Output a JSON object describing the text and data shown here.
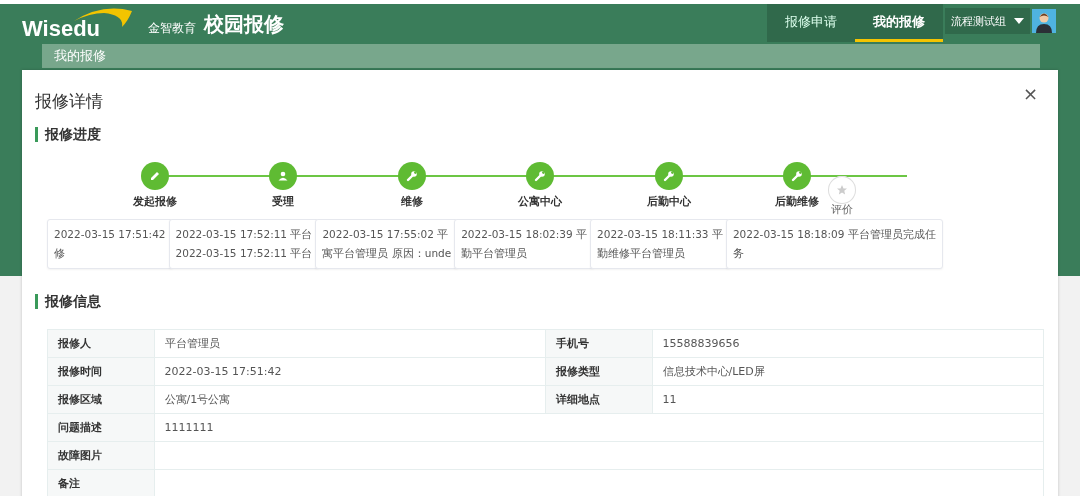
{
  "header": {
    "logo": "Wisedu",
    "company": "金智教育",
    "title": "校园报修",
    "nav": [
      {
        "label": "报修申请",
        "selected": false
      },
      {
        "label": "我的报修",
        "selected": true
      }
    ],
    "user": "流程测试组"
  },
  "breadcrumb": "我的报修",
  "dialog": {
    "title": "报修详情",
    "close": "×",
    "progress": {
      "heading": "报修进度",
      "steps": [
        {
          "label": "发起报修",
          "kind": "pencil",
          "done": true
        },
        {
          "label": "受理",
          "kind": "person",
          "done": true
        },
        {
          "label": "维修",
          "kind": "wrench",
          "done": true
        },
        {
          "label": "公寓中心",
          "kind": "wrench",
          "done": true
        },
        {
          "label": "后勤中心",
          "kind": "wrench",
          "done": true
        },
        {
          "label": "后勤维修",
          "kind": "wrench",
          "done": true
        },
        {
          "label": "评价",
          "kind": "star",
          "done": false
        }
      ],
      "logs": [
        {
          "lines": [
            "2022-03-15 17:51:42",
            "修"
          ]
        },
        {
          "lines": [
            "2022-03-15 17:52:11 平台",
            "2022-03-15 17:52:11 平台"
          ]
        },
        {
          "lines": [
            "2022-03-15 17:55:02 平",
            "寓平台管理员 原因：unde"
          ]
        },
        {
          "lines": [
            "2022-03-15 18:02:39 平",
            "勤平台管理员"
          ]
        },
        {
          "lines": [
            "2022-03-15 18:11:33 平",
            "勤维修平台管理员"
          ]
        },
        {
          "lines": [
            "2022-03-15 18:18:09 平台管理员完成任",
            "务"
          ]
        }
      ]
    },
    "info": {
      "heading": "报修信息",
      "rows": [
        [
          {
            "label": "报修人",
            "value": "平台管理员"
          },
          {
            "label": "手机号",
            "value": "15588839656"
          }
        ],
        [
          {
            "label": "报修时间",
            "value": "2022-03-15 17:51:42"
          },
          {
            "label": "报修类型",
            "value": "信息技术中心/LED屏"
          }
        ],
        [
          {
            "label": "报修区域",
            "value": "公寓/1号公寓"
          },
          {
            "label": "详细地点",
            "value": "11"
          }
        ],
        [
          {
            "label": "问题描述",
            "value": "1111111"
          }
        ],
        [
          {
            "label": "故障图片"
          }
        ],
        [
          {
            "label": "备注"
          }
        ]
      ]
    }
  }
}
